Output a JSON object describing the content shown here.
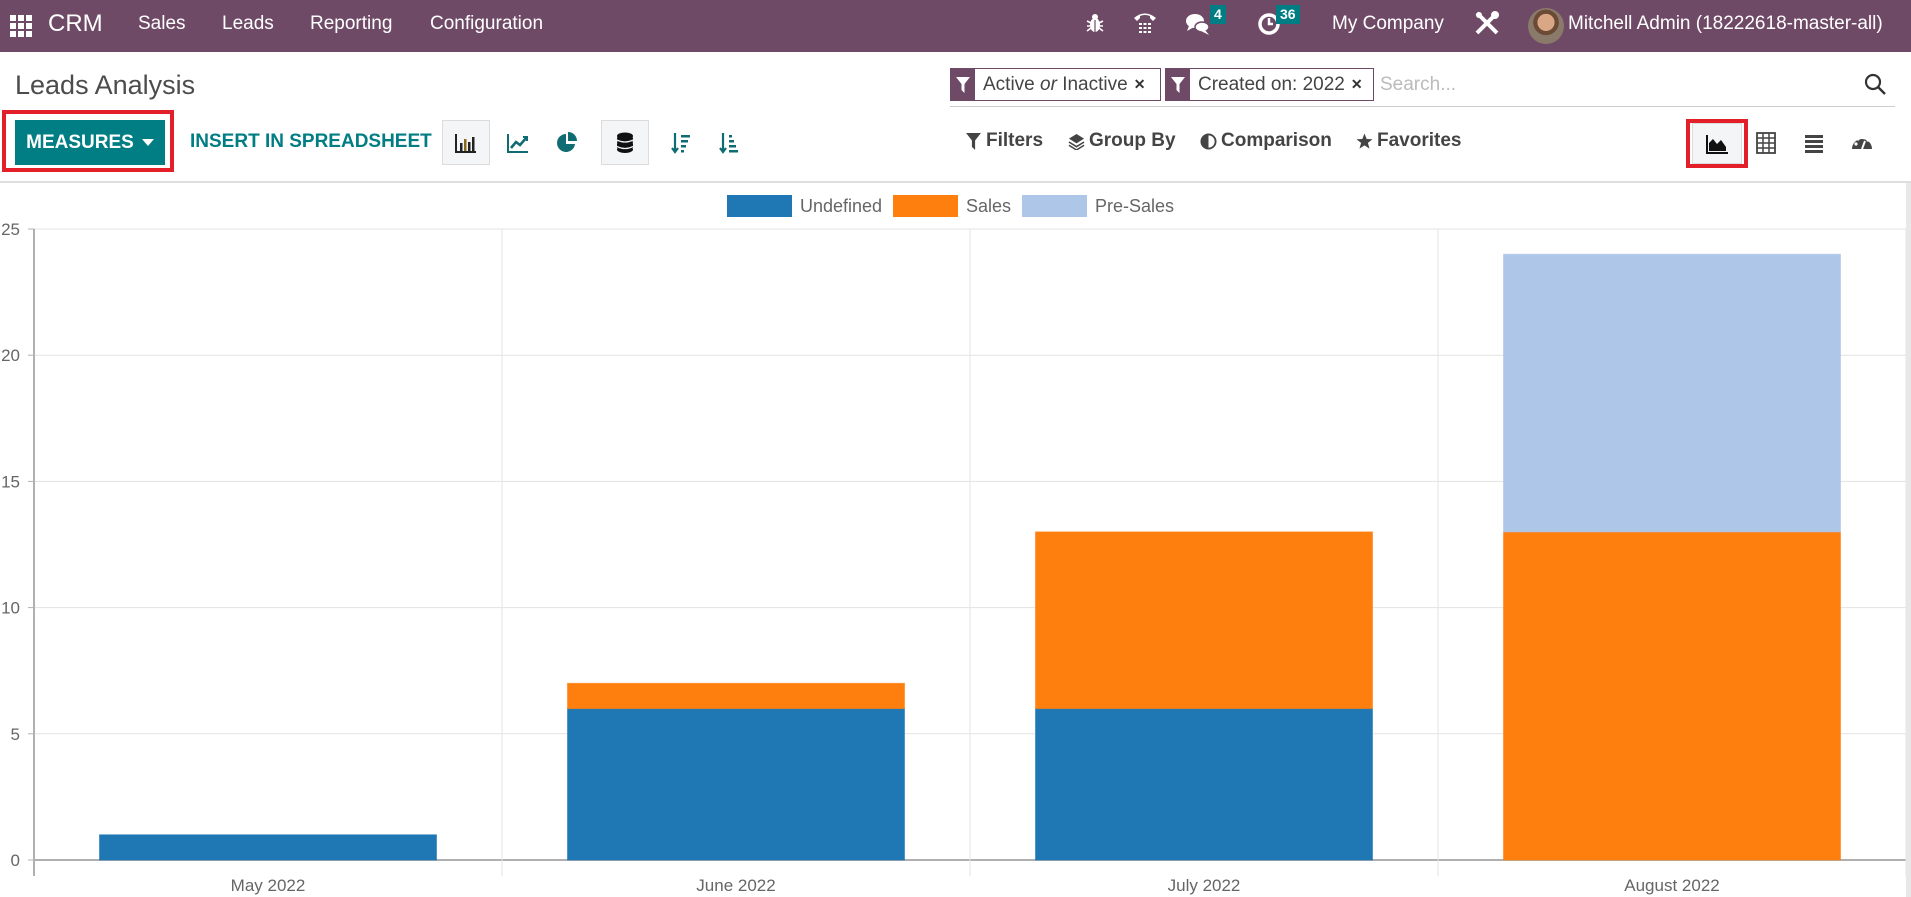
{
  "navbar": {
    "app_name": "CRM",
    "menu": [
      "Sales",
      "Leads",
      "Reporting",
      "Configuration"
    ],
    "icons": {
      "debug": "bug-icon",
      "voip": "phone-icon",
      "messages": "chat-icon",
      "activities": "clock-icon",
      "settings": "tools-icon"
    },
    "messages_count": "4",
    "activities_count": "36",
    "company": "My Company",
    "user": "Mitchell Admin (18222618-master-all)"
  },
  "page": {
    "title": "Leads Analysis"
  },
  "search": {
    "facets": [
      {
        "prefix": "Active ",
        "em": "or",
        "suffix": " Inactive"
      },
      {
        "label": "Created on: 2022"
      }
    ],
    "placeholder": "Search..."
  },
  "toolbar": {
    "measures_label": "MEASURES",
    "insert_label": "INSERT IN SPREADSHEET",
    "chart_types": [
      "bar",
      "line",
      "pie"
    ],
    "active_chart_type": "bar",
    "stacked": true,
    "filters_label": "Filters",
    "groupby_label": "Group By",
    "comparison_label": "Comparison",
    "favorites_label": "Favorites",
    "views": [
      "graph",
      "pivot",
      "list",
      "dashboard"
    ],
    "active_view": "graph"
  },
  "colors": {
    "navbar": "#6f4a66",
    "primary": "#017e84",
    "highlight": "#e3202a"
  },
  "chart_data": {
    "type": "bar",
    "stacked": true,
    "categories": [
      "May 2022",
      "June 2022",
      "July 2022",
      "August 2022"
    ],
    "series": [
      {
        "name": "Undefined",
        "color": "#1f77b4",
        "values": [
          1,
          6,
          6,
          0
        ]
      },
      {
        "name": "Sales",
        "color": "#ff7f0e",
        "values": [
          0,
          1,
          7,
          13
        ]
      },
      {
        "name": "Pre-Sales",
        "color": "#aec7e8",
        "values": [
          0,
          0,
          0,
          11
        ]
      }
    ],
    "yticks": [
      0,
      5,
      10,
      15,
      20,
      25
    ],
    "ylim": [
      0,
      25
    ],
    "xlabel": "",
    "ylabel": "",
    "legend": "top-center",
    "grid": true
  }
}
